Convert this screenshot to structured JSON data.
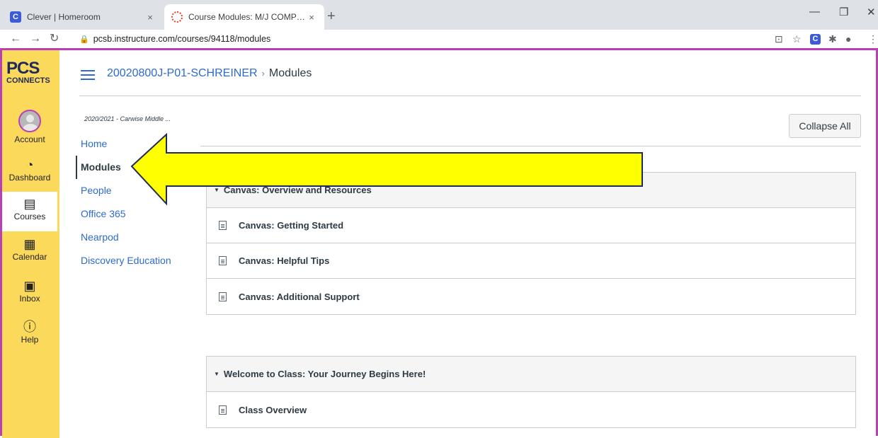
{
  "browser": {
    "tabs": [
      {
        "title": "Clever | Homeroom",
        "favicon": "C",
        "active": false
      },
      {
        "title": "Course Modules: M/J COMPRE S…",
        "active": true
      }
    ],
    "close_glyph": "×",
    "new_tab_glyph": "+",
    "url": "pcsb.instructure.com/courses/94118/modules",
    "extension_letter": "C"
  },
  "globalnav": {
    "logo_top": "PCS",
    "logo_bottom": "CONNECTS",
    "items": [
      {
        "label": "Account",
        "icon": "avatar-icon"
      },
      {
        "label": "Dashboard",
        "icon": "dashboard-icon"
      },
      {
        "label": "Courses",
        "icon": "book-icon"
      },
      {
        "label": "Calendar",
        "icon": "calendar-icon"
      },
      {
        "label": "Inbox",
        "icon": "inbox-icon"
      },
      {
        "label": "Help",
        "icon": "help-icon"
      }
    ]
  },
  "header": {
    "course": "20020800J-P01-SCHREINER",
    "separator": "›",
    "page": "Modules"
  },
  "course_nav": {
    "term": "2020/2021 - Carwise Middle ...",
    "items": [
      {
        "label": "Home",
        "active": false
      },
      {
        "label": "Modules",
        "active": true
      },
      {
        "label": "People",
        "active": false
      },
      {
        "label": "Office 365",
        "active": false
      },
      {
        "label": "Nearpod",
        "active": false
      },
      {
        "label": "Discovery Education",
        "active": false
      }
    ]
  },
  "content": {
    "collapse_label": "Collapse All",
    "modules": [
      {
        "title": "Canvas: Overview and Resources",
        "items": [
          "Canvas: Getting Started",
          "Canvas: Helpful Tips",
          "Canvas: Additional Support"
        ]
      },
      {
        "title": "Welcome to Class: Your Journey Begins Here!",
        "items": [
          "Class Overview"
        ]
      }
    ]
  },
  "colors": {
    "globalnav_bg": "#fbd95b",
    "frame_border": "#b93fb6",
    "link": "#2d6ad1",
    "arrow_fill": "#ffff00",
    "arrow_stroke": "#1e2b5c"
  }
}
